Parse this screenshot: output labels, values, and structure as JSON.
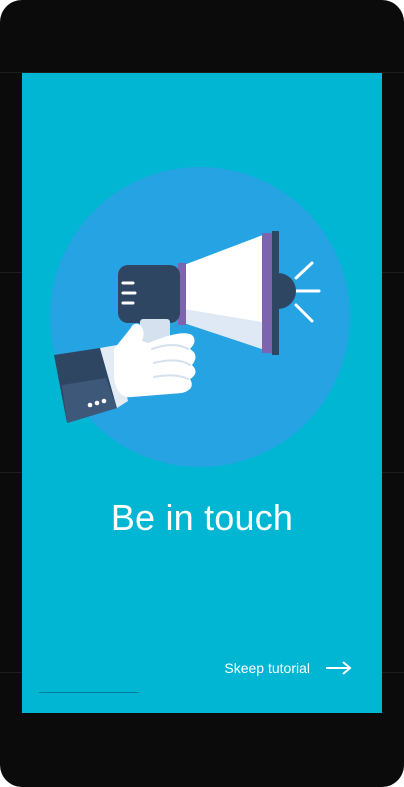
{
  "onboarding": {
    "headline": "Be in touch",
    "skip_label": "Skeep tutorial",
    "illustration": "megaphone-in-hand",
    "icons": {
      "skip": "arrow-right-icon"
    }
  },
  "colors": {
    "background": "#00b6d3",
    "circle": "#26a3e3",
    "megaphone_dark": "#2e4661",
    "megaphone_accent": "#7c64ae",
    "text": "#ffffff"
  }
}
